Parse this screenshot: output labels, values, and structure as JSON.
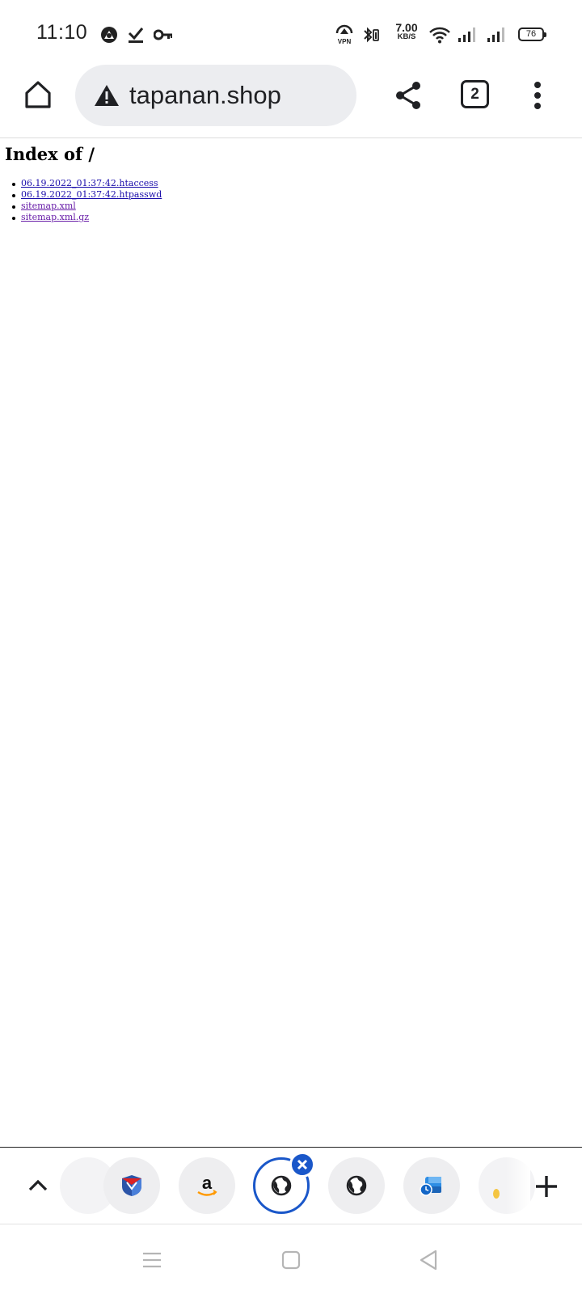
{
  "status_bar": {
    "time": "11:10",
    "network_speed_value": "7.00",
    "network_speed_unit": "KB/S",
    "battery_level": "76",
    "left_icons": [
      "notification-app-icon",
      "check-icon",
      "key-icon"
    ],
    "right_icons": [
      "vpn-icon",
      "bluetooth-icon",
      "wifi-icon",
      "signal-icon",
      "signal-icon"
    ]
  },
  "toolbar": {
    "url": "tapanan.shop",
    "tab_count": "2",
    "security_state": "warning-icon"
  },
  "page": {
    "heading": "Index of /",
    "files": [
      {
        "name": "06.19.2022_01:37:42.htaccess",
        "visited": false
      },
      {
        "name": "06.19.2022_01:37:42.htpasswd",
        "visited": false
      },
      {
        "name": "sitemap.xml",
        "visited": true
      },
      {
        "name": "sitemap.xml.gz",
        "visited": true
      }
    ]
  },
  "tab_strip": {
    "tabs": [
      {
        "icon": "shield-app-icon",
        "active": false
      },
      {
        "icon": "amazon-icon",
        "active": false
      },
      {
        "icon": "globe-icon",
        "active": true
      },
      {
        "icon": "globe-icon",
        "active": false
      },
      {
        "icon": "outlook-icon",
        "active": false
      }
    ],
    "accent_color": "#1a57c9"
  }
}
